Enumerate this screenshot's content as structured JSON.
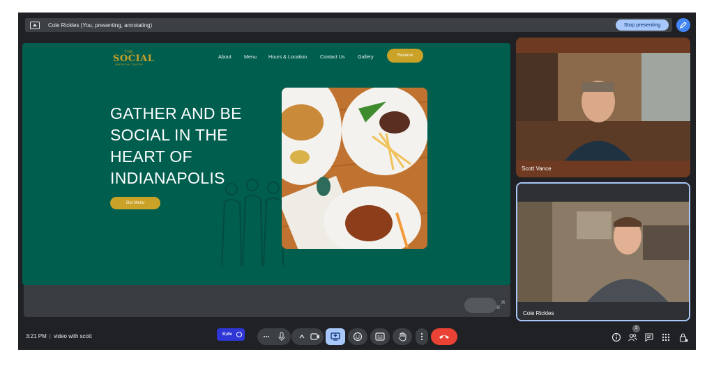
{
  "presenting_bar": {
    "text": "Cole Rickles (You, presenting, annotating)",
    "stop_label": "Stop presenting"
  },
  "website": {
    "logo": {
      "top": "THE",
      "main": "SOCIAL",
      "sub": "AMERICAN TAVERN"
    },
    "nav": [
      "About",
      "Menu",
      "Hours & Location",
      "Contact Us",
      "Gallery"
    ],
    "reserve_label": "Reserve",
    "hero_title": "GATHER AND BE SOCIAL IN THE HEART OF INDIANAPOLIS",
    "menu_button": "Our Menu",
    "colors": {
      "background": "#005e4f",
      "accent": "#c9a227"
    }
  },
  "participants": [
    {
      "name": "Scott Vance"
    },
    {
      "name": "Cole Rickles"
    }
  ],
  "bottom_bar": {
    "time": "3:21 PM",
    "meeting_title": "video with scott",
    "caption_badge": "tl;dv",
    "people_count": "3",
    "controls": [
      "more-options-icon",
      "microphone-icon",
      "chevron-up-icon",
      "camera-icon",
      "present-screen-icon",
      "emoji-icon",
      "captions-icon",
      "raise-hand-icon",
      "more-vert-icon",
      "end-call-icon"
    ],
    "right_icons": [
      "info-icon",
      "people-icon",
      "chat-icon",
      "activities-icon",
      "host-controls-icon"
    ]
  }
}
